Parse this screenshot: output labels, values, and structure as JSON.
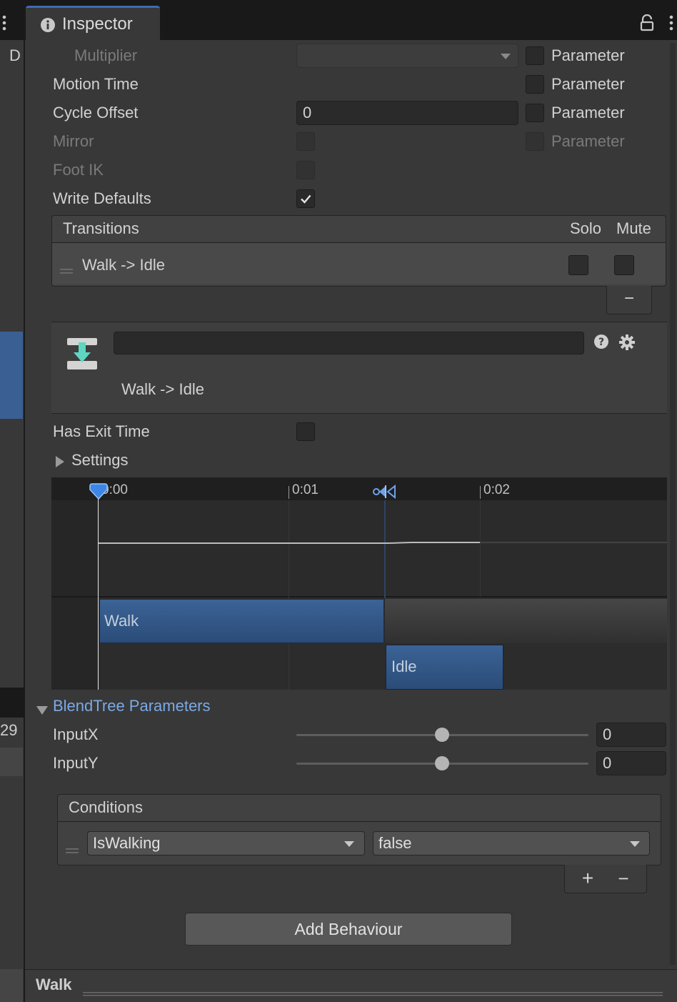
{
  "window": {
    "tab_title": "Inspector",
    "left_strip": {
      "top_letter": "D",
      "bottom_number": "29"
    }
  },
  "motion": {
    "multiplier_label": "Multiplier",
    "multiplier_value": "",
    "motion_time_label": "Motion Time",
    "cycle_offset_label": "Cycle Offset",
    "cycle_offset_value": "0",
    "mirror_label": "Mirror",
    "foot_ik_label": "Foot IK",
    "write_defaults_label": "Write Defaults",
    "write_defaults_checked": true,
    "parameter_label": "Parameter"
  },
  "transitions": {
    "header": "Transitions",
    "solo_label": "Solo",
    "mute_label": "Mute",
    "items": [
      {
        "name": "Walk -> Idle",
        "solo": false,
        "mute": false
      }
    ],
    "remove_symbol": "−"
  },
  "transition_detail": {
    "name_value": "",
    "title": "Walk -> Idle",
    "has_exit_time_label": "Has Exit Time",
    "has_exit_time_checked": false,
    "settings_label": "Settings"
  },
  "timeline": {
    "ticks": [
      "0:00",
      "0:01",
      "0:02"
    ],
    "clips": [
      {
        "name": "Walk"
      },
      {
        "name": "Idle"
      }
    ]
  },
  "blend_tree": {
    "header": "BlendTree Parameters",
    "params": [
      {
        "name": "InputX",
        "value": "0",
        "slider_fraction": 0.5
      },
      {
        "name": "InputY",
        "value": "0",
        "slider_fraction": 0.5
      }
    ]
  },
  "conditions": {
    "header": "Conditions",
    "items": [
      {
        "parameter": "IsWalking",
        "value": "false"
      }
    ],
    "add_symbol": "+",
    "remove_symbol": "−"
  },
  "add_behaviour_label": "Add Behaviour",
  "footer": {
    "title": "Walk"
  },
  "colors": {
    "accent_blue": "#2f5b91",
    "link_blue": "#7ba9e6",
    "arrow_teal": "#5fd6c1"
  },
  "icons": [
    "info-icon",
    "lock-icon",
    "kebab-menu-icon",
    "dropdown-caret-icon",
    "drag-handle-icon",
    "transition-icon",
    "help-icon",
    "gear-icon",
    "foldout-arrow-icon",
    "playhead-marker-icon"
  ]
}
